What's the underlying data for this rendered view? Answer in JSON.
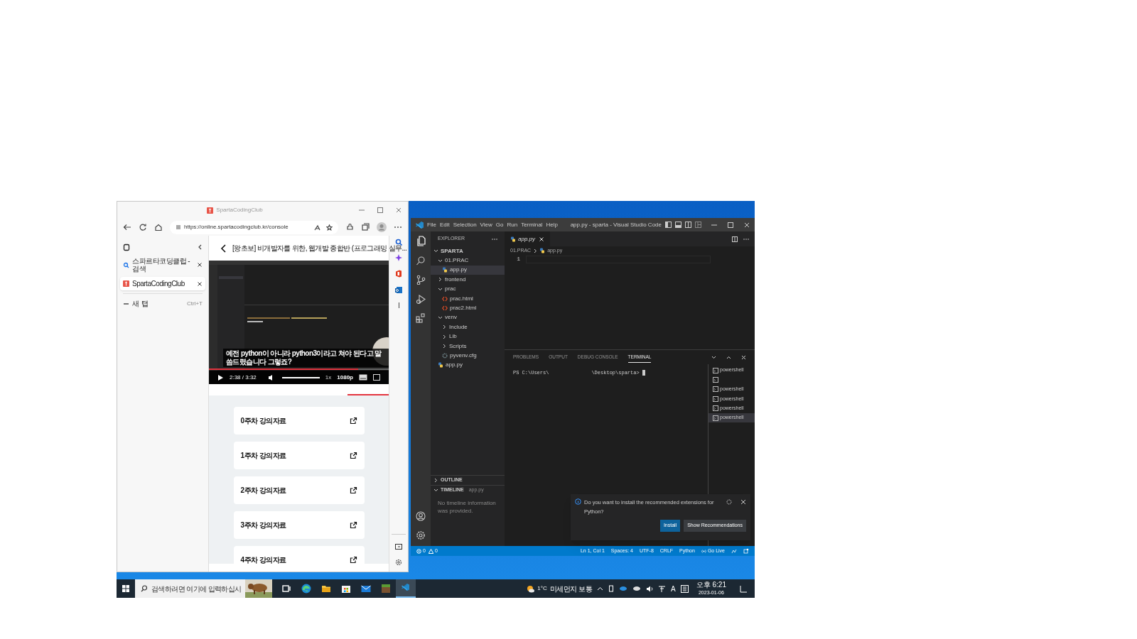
{
  "browser": {
    "title": "SpartaCodingClub",
    "url": "https://online.spartacodingclub.kr/console",
    "tabs": [
      {
        "label": "스파르타코딩클럽 - 검색",
        "kind": "search",
        "selected": false
      },
      {
        "label": "SpartaCodingClub",
        "kind": "site",
        "selected": true
      }
    ],
    "new_tab": {
      "label": "새 탭",
      "shortcut": "Ctrl+T"
    },
    "course_title": "[왕초보] 비개발자를 위한, 웹개발 종합반 (프로그래밍 실무...",
    "video": {
      "subtitle": "예전 python이 아니라 python3이라고 쳐야 된다고 말씀드렸습니다 그렇죠?",
      "time": "2:38 / 3:32",
      "speed": "1x",
      "quality": "1080p",
      "progress": {
        "level": 0.83
      },
      "volume": {
        "level": 1
      }
    },
    "materials": [
      {
        "label": "0주차 강의자료"
      },
      {
        "label": "1주차 강의자료"
      },
      {
        "label": "2주차 강의자료"
      },
      {
        "label": "3주차 강의자료"
      },
      {
        "label": "4주차 강의자료"
      }
    ]
  },
  "vscode": {
    "menu": [
      "File",
      "Edit",
      "Selection",
      "View",
      "Go",
      "Run",
      "Terminal",
      "Help"
    ],
    "title": "app.py - sparta - Visual Studio Code",
    "explorer": {
      "header": "EXPLORER",
      "tree": [
        {
          "label": "SPARTA",
          "kind": "root",
          "expanded": true,
          "selected": false,
          "children": [
            {
              "label": "01.PRAC",
              "kind": "folder",
              "expanded": true,
              "selected": false,
              "children": [
                {
                  "label": "app.py",
                  "kind": "python",
                  "selected": true
                }
              ]
            },
            {
              "label": "frontend",
              "kind": "folder",
              "expanded": false,
              "selected": false
            },
            {
              "label": "prac",
              "kind": "folder",
              "expanded": true,
              "selected": false,
              "children": [
                {
                  "label": "prac.html",
                  "kind": "html",
                  "selected": false
                },
                {
                  "label": "prac2.html",
                  "kind": "html",
                  "selected": false
                }
              ]
            },
            {
              "label": "venv",
              "kind": "folder",
              "expanded": true,
              "selected": false,
              "children": [
                {
                  "label": "Include",
                  "kind": "folder",
                  "expanded": false,
                  "selected": false
                },
                {
                  "label": "Lib",
                  "kind": "folder",
                  "expanded": false,
                  "selected": false
                },
                {
                  "label": "Scripts",
                  "kind": "folder",
                  "expanded": false,
                  "selected": false
                },
                {
                  "label": "pyvenv.cfg",
                  "kind": "config",
                  "selected": false
                }
              ]
            },
            {
              "label": "app.py",
              "kind": "python",
              "selected": false
            }
          ]
        }
      ],
      "outline": "OUTLINE",
      "timeline": "TIMELINE",
      "timeline_file": "app.py",
      "timeline_message": "No timeline information was provided."
    },
    "editor_tab": "app.py",
    "breadcrumb": [
      "01.PRAC",
      "app.py"
    ],
    "line_numbers": [
      "1"
    ],
    "panel_tabs": [
      {
        "label": "PROBLEMS",
        "selected": false
      },
      {
        "label": "OUTPUT",
        "selected": false
      },
      {
        "label": "DEBUG CONSOLE",
        "selected": false
      },
      {
        "label": "TERMINAL",
        "selected": true
      }
    ],
    "terminal_prompt": [
      "PS C:\\Users\\",
      "\\Desktop\\sparta>"
    ],
    "terminals": [
      {
        "label": "powershell",
        "selected": false
      },
      {
        "selected": false
      },
      {
        "label": "powershell",
        "selected": false
      },
      {
        "label": "powershell",
        "selected": false
      },
      {
        "label": "powershell",
        "selected": false
      },
      {
        "label": "powershell",
        "selected": true
      }
    ],
    "notification": {
      "message": "Do you want to install the recommended extensions for Python?",
      "buttons": [
        {
          "label": "Install",
          "kind": "primary"
        },
        {
          "label": "Show Recommendations",
          "kind": "secondary"
        }
      ]
    },
    "status": {
      "errors": "0",
      "warnings": "0",
      "items": [
        {
          "label": "Ln 1, Col 1",
          "kind": "text"
        },
        {
          "label": "Spaces: 4",
          "kind": "text"
        },
        {
          "label": "UTF-8",
          "kind": "text"
        },
        {
          "label": "CRLF",
          "kind": "text"
        },
        {
          "label": "Python",
          "kind": "text"
        },
        {
          "label": "Go Live",
          "kind": "golive"
        }
      ]
    }
  },
  "taskbar": {
    "search_placeholder": "검색하려면 여기에 입력하십시",
    "weather": {
      "temperature": "1°C",
      "text": "미세먼지 보통"
    },
    "ime": "A",
    "time": "오후 6:21",
    "date": "2023-01-06"
  }
}
